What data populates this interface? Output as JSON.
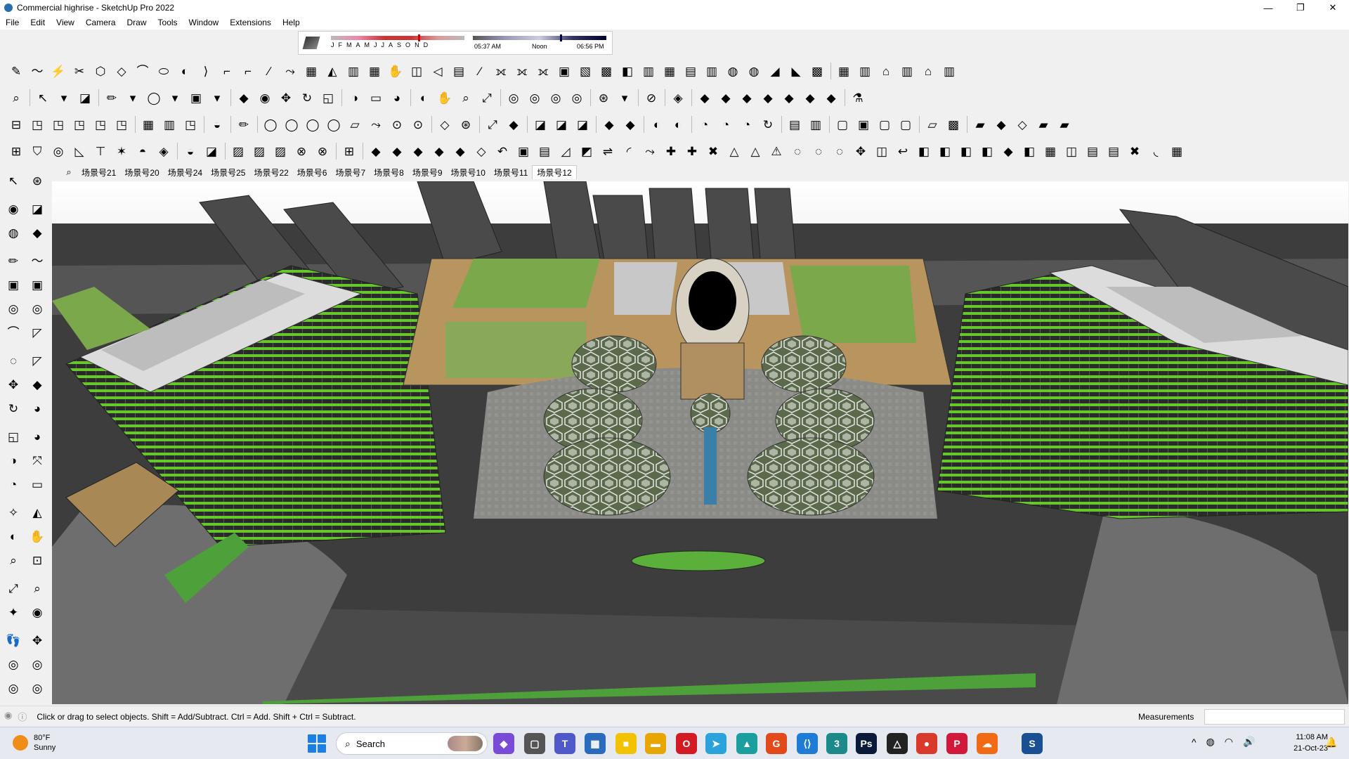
{
  "window": {
    "title": "Commercial highrise - SketchUp Pro 2022",
    "controls": {
      "minimize": "—",
      "maximize": "❐",
      "close": "✕"
    }
  },
  "menu": [
    "File",
    "Edit",
    "View",
    "Camera",
    "Draw",
    "Tools",
    "Window",
    "Extensions",
    "Help"
  ],
  "shadow_settings": {
    "months": [
      "J",
      "F",
      "M",
      "A",
      "M",
      "J",
      "J",
      "A",
      "S",
      "O",
      "N",
      "D"
    ],
    "sunrise": "05:37 AM",
    "noon": "Noon",
    "sunset": "06:56 PM",
    "month_position": 0.65,
    "time_position": 0.65
  },
  "toolbars": {
    "row1": [
      "✎",
      "〜",
      "⚡",
      "✂",
      "⬡",
      "◇",
      "⌒",
      "⬭",
      "◐",
      "⟩",
      "⌐",
      "⌐",
      "∕",
      "⤳",
      "▦",
      "◭",
      "▥",
      "▦",
      "✋",
      "◫",
      "◁",
      "▤",
      "⁄",
      "⟗",
      "⟗",
      "⟗",
      "▣",
      "▧",
      "▩",
      "◧",
      "▥",
      "▦",
      "▤",
      "▥",
      "◍",
      "◍",
      "◢",
      "◣",
      "▩",
      "|",
      "▦",
      "▥",
      "⌂",
      "▥",
      "⌂",
      "▥"
    ],
    "row2": [
      "⌕",
      "|",
      "↖",
      "▾",
      "◪",
      "|",
      "✏",
      "▾",
      "◯",
      "▾",
      "▣",
      "▾",
      "|",
      "◆",
      "◉",
      "✥",
      "↻",
      "◱",
      "|",
      "◑",
      "▭",
      "◕",
      "|",
      "◐",
      "✋",
      "⌕",
      "⤢",
      "|",
      "◎",
      "◎",
      "◎",
      "◎",
      "|",
      "⊛",
      "▾",
      "|",
      "⊘",
      "|",
      "◈",
      "|",
      "◆",
      "◆",
      "◆",
      "◆",
      "◆",
      "◆",
      "◆",
      "|",
      "⚗"
    ],
    "row3": [
      "⊟",
      "◳",
      "◳",
      "◳",
      "◳",
      "◳",
      "|",
      "▦",
      "▥",
      "◳",
      "|",
      "◒",
      "|",
      "✏",
      "|",
      "◯",
      "◯",
      "◯",
      "◯",
      "▱",
      "⤳",
      "⊙",
      "⊙",
      "|",
      "◇",
      "⊛",
      "|",
      "⤢",
      "◆",
      "|",
      "◪",
      "◪",
      "◪",
      "|",
      "◆",
      "◆",
      "|",
      "◐",
      "◐",
      "|",
      "◔",
      "◔",
      "◔",
      "↻",
      "|",
      "▤",
      "▥",
      "|",
      "▢",
      "▣",
      "▢",
      "▢",
      "|",
      "▱",
      "▩",
      "|",
      "▰",
      "◆",
      "◇",
      "▰",
      "▰"
    ],
    "row4": [
      "⊞",
      "⛉",
      "◎",
      "◺",
      "⊤",
      "✶",
      "◓",
      "◈",
      "|",
      "◒",
      "◪",
      "|",
      "▨",
      "▨",
      "▨",
      "⊗",
      "⊗",
      "|",
      "⊞",
      "|",
      "◆",
      "◆",
      "◆",
      "◆",
      "◆",
      "◇",
      "↶",
      "▣",
      "▤",
      "◿",
      "◩",
      "⇌",
      "◜",
      "⤳",
      "✚",
      "✚",
      "✖",
      "△",
      "△",
      "⚠",
      "◌",
      "◌",
      "◌",
      "✥",
      "◫",
      "↩",
      "◧",
      "◧",
      "◧",
      "◧",
      "◆",
      "◧",
      "▦",
      "◫",
      "▤",
      "▤",
      "✖",
      "◟",
      "▦"
    ]
  },
  "sidebar_tools": [
    "↖",
    "⊛",
    "◉",
    "◪",
    "◍",
    "◆",
    "✏",
    "〜",
    "▣",
    "▣",
    "◎",
    "◎",
    "⌒",
    "◸",
    "◌",
    "◸",
    "✥",
    "◆",
    "↻",
    "◕",
    "◱",
    "◕",
    "◑",
    "⤧",
    "◔",
    "▭",
    "✧",
    "◭",
    "◐",
    "✋",
    "⌕",
    "⊡",
    "⤢",
    "⌕",
    "✦",
    "◉",
    "👣",
    "✥",
    "◎",
    "◎",
    "◎",
    "◎"
  ],
  "scene_tabs": [
    "场景号21",
    "场景号20",
    "场景号24",
    "场景号25",
    "场景号22",
    "场景号6",
    "场景号7",
    "场景号8",
    "场景号9",
    "场景号10",
    "场景号11",
    "场景号12"
  ],
  "scene_search_icon": "⌕",
  "active_scene": "场景号12",
  "status": {
    "hint": "Click or drag to select objects. Shift = Add/Subtract. Ctrl = Add. Shift + Ctrl = Subtract.",
    "measurements_label": "Measurements",
    "measurements_value": "",
    "icons": [
      "◉",
      "ⓘ"
    ]
  },
  "taskbar": {
    "weather_temp": "80°F",
    "weather_desc": "Sunny",
    "search_placeholder": "Search",
    "search_glyph": "⌕",
    "apps": [
      {
        "name": "copilot",
        "glyph": "◆",
        "color": "#7a4bd6"
      },
      {
        "name": "task-view",
        "glyph": "▢",
        "color": "#555"
      },
      {
        "name": "teams",
        "glyph": "T",
        "color": "#5059c9"
      },
      {
        "name": "calculator",
        "glyph": "▦",
        "color": "#2a6bbd"
      },
      {
        "name": "sticky-notes",
        "glyph": "■",
        "color": "#f2c200"
      },
      {
        "name": "file-explorer",
        "glyph": "▬",
        "color": "#e7a600"
      },
      {
        "name": "opera",
        "glyph": "O",
        "color": "#d41b24"
      },
      {
        "name": "telegram",
        "glyph": "➤",
        "color": "#2aa3dc"
      },
      {
        "name": "maps",
        "glyph": "▲",
        "color": "#1a9e9e"
      },
      {
        "name": "shield",
        "glyph": "G",
        "color": "#e24a1c"
      },
      {
        "name": "vscode",
        "glyph": "⟨⟩",
        "color": "#1e7bd6"
      },
      {
        "name": "app-3",
        "glyph": "3",
        "color": "#1d8a8a"
      },
      {
        "name": "photoshop",
        "glyph": "Ps",
        "color": "#0a1a3a"
      },
      {
        "name": "vectorworks",
        "glyph": "△",
        "color": "#222"
      },
      {
        "name": "chrome",
        "glyph": "●",
        "color": "#d93a2b"
      },
      {
        "name": "pinterest",
        "glyph": "P",
        "color": "#d3193b"
      },
      {
        "name": "soundcloud",
        "glyph": "☁",
        "color": "#f26a13"
      },
      {
        "name": "sketchup",
        "glyph": "S",
        "color": "#1b4f93"
      }
    ],
    "tray": [
      "^",
      "◍",
      "◠",
      "🔊"
    ],
    "time": "11:08 AM",
    "date": "21-Oct-23",
    "bell": "🔔"
  },
  "colors": {
    "sky": "#ffffff",
    "ground": "#3d3d3d",
    "green": "#6ccf3a",
    "sand": "#b8955e",
    "glass": "#1a1a1a"
  }
}
